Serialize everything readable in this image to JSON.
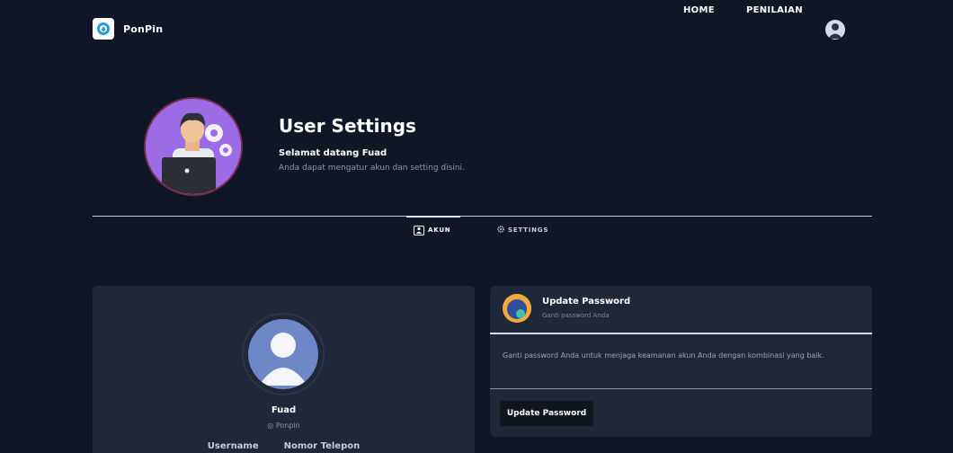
{
  "nav": {
    "brand": "PonPin",
    "links": [
      "HOME",
      "PENILAIAN"
    ]
  },
  "header": {
    "title": "User Settings",
    "welcome": "Selamat datang Fuad",
    "description": "Anda dapat mengatur akun dan setting disini."
  },
  "tabs": [
    {
      "label": "AKUN",
      "active": true
    },
    {
      "label": "SETTINGS",
      "active": false
    }
  ],
  "profile": {
    "name": "Fuad",
    "location": "Ponpin",
    "fields": [
      "Username",
      "Nomor Telepon"
    ]
  },
  "password_card": {
    "title": "Update Password",
    "subtitle": "Ganti password Anda",
    "body": "Ganti password Anda untuk menjaga keamanan akun Anda dengan kombinasi yang baik.",
    "button": "Update Password"
  },
  "colors": {
    "background": "#0f1727",
    "card": "#1f2838",
    "accent_purple": "#9c6ce6"
  }
}
